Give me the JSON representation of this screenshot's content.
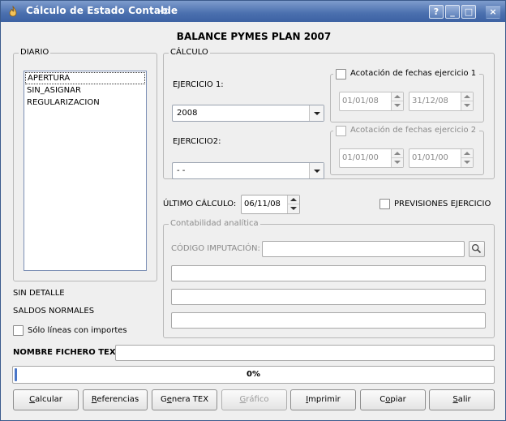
{
  "window": {
    "title": "Cálculo de Estado Contable",
    "buttons": {
      "help": "?",
      "minimize": "_",
      "maximize": "□",
      "close": "×"
    }
  },
  "heading": "BALANCE PYMES PLAN 2007",
  "diario": {
    "label": "DIARIO",
    "items": [
      "APERTURA",
      "SIN_ASIGNAR",
      "REGULARIZACION"
    ],
    "selected_index": 0,
    "sin_detalle": "SIN DETALLE",
    "saldos_normales": "SALDOS NORMALES",
    "solo_lineas_label": "Sólo líneas con importes"
  },
  "calculo": {
    "label": "CÁLCULO",
    "ejercicio1": {
      "label": "EJERCICIO 1:",
      "value": "2008",
      "acotacion_label": "Acotación de fechas ejercicio 1",
      "date_from": "01/01/08",
      "date_to": "31/12/08"
    },
    "ejercicio2": {
      "label": "EJERCICIO2:",
      "value": "- -",
      "acotacion_label": "Acotación de fechas ejercicio 2",
      "date_from": "01/01/00",
      "date_to": "01/01/00"
    }
  },
  "ultimo_calculo": {
    "label": "ÚLTIMO CÁLCULO:",
    "value": "06/11/08"
  },
  "previsiones_label": "PREVISIONES EJERCICIO",
  "analitica": {
    "label": "Contabilidad analítica",
    "codigo_label": "CÓDIGO IMPUTACIÓN:",
    "codigo_value": ""
  },
  "nombre_fichero": {
    "label": "NOMBRE FICHERO TEX:",
    "value": ""
  },
  "progress": {
    "value": 0,
    "text": "0%"
  },
  "buttons": {
    "calcular": {
      "mnemonic": "C",
      "rest": "alcular"
    },
    "referencias": {
      "mnemonic": "R",
      "rest": "eferencias"
    },
    "genera_tex": {
      "pre": "G",
      "mnemonic": "e",
      "rest": "nera TEX"
    },
    "grafico": {
      "mnemonic": "G",
      "rest": "ráfico"
    },
    "imprimir": {
      "mnemonic": "I",
      "rest": "mprimir"
    },
    "copiar": {
      "pre": "C",
      "mnemonic": "o",
      "rest": "piar"
    },
    "salir": {
      "mnemonic": "S",
      "rest": "alir"
    }
  },
  "colors": {
    "titlebar": "#4a6fae",
    "progress_fill": "#4a76c8"
  }
}
